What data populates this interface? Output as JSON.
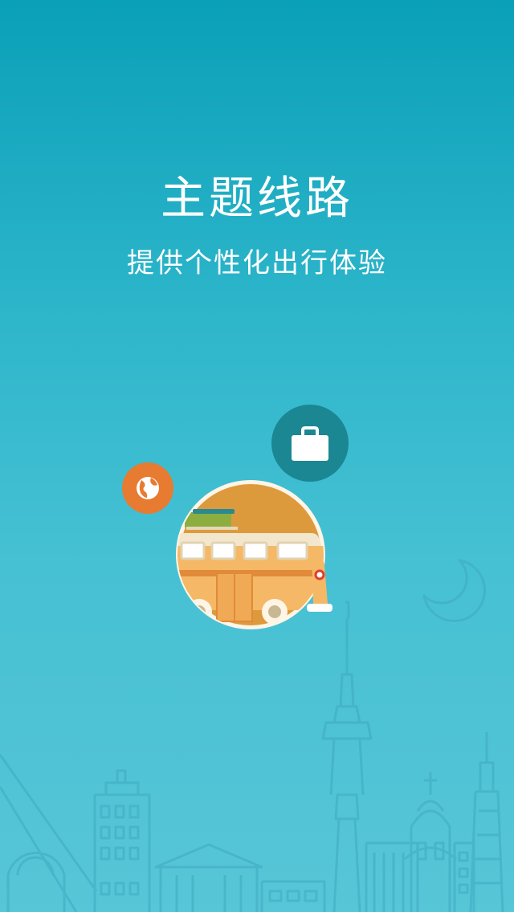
{
  "onboarding": {
    "title": "主题线路",
    "subtitle": "提供个性化出行体验"
  },
  "icons": {
    "bag": "briefcase-icon",
    "globe": "globe-icon",
    "bus": "bus-illustration",
    "moon": "crescent-moon-icon",
    "skyline": "city-skyline-outline"
  },
  "colors": {
    "background_top": "#0aa0b8",
    "background_bottom": "#57c6d7",
    "bag_bubble": "#1b8793",
    "globe_bubble": "#e77b31",
    "bus_disc": "#dd9a3c",
    "bus_body": "#f5b866"
  }
}
